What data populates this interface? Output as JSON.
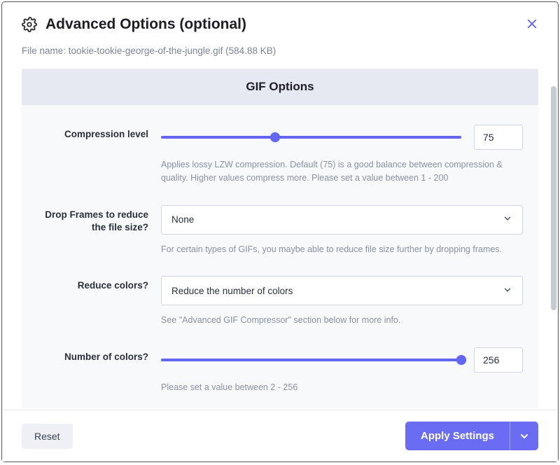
{
  "header": {
    "title": "Advanced Options (optional)"
  },
  "file": {
    "label": "File name:",
    "value": "tookie-tookie-george-of-the-jungle.gif (584.88 KB)"
  },
  "section_title": "GIF Options",
  "compression": {
    "label": "Compression level",
    "value": "75",
    "slider_fill_pct": 38,
    "track_filled_pct": 100,
    "help": "Applies lossy LZW compression. Default (75) is a good balance between compression & quality. Higher values compress more. Please set a value between 1 - 200"
  },
  "drop_frames": {
    "label": "Drop Frames to reduce the file size?",
    "selected": "None",
    "help": "For certain types of GIFs, you maybe able to reduce file size further by dropping frames."
  },
  "reduce_colors": {
    "label": "Reduce colors?",
    "selected": "Reduce the number of colors",
    "help": "See \"Advanced GIF Compressor\" section below for more info."
  },
  "num_colors": {
    "label": "Number of colors?",
    "value": "256",
    "slider_fill_pct": 100,
    "help": "Please set a value between 2 - 256"
  },
  "footer": {
    "reset": "Reset",
    "apply": "Apply Settings"
  }
}
